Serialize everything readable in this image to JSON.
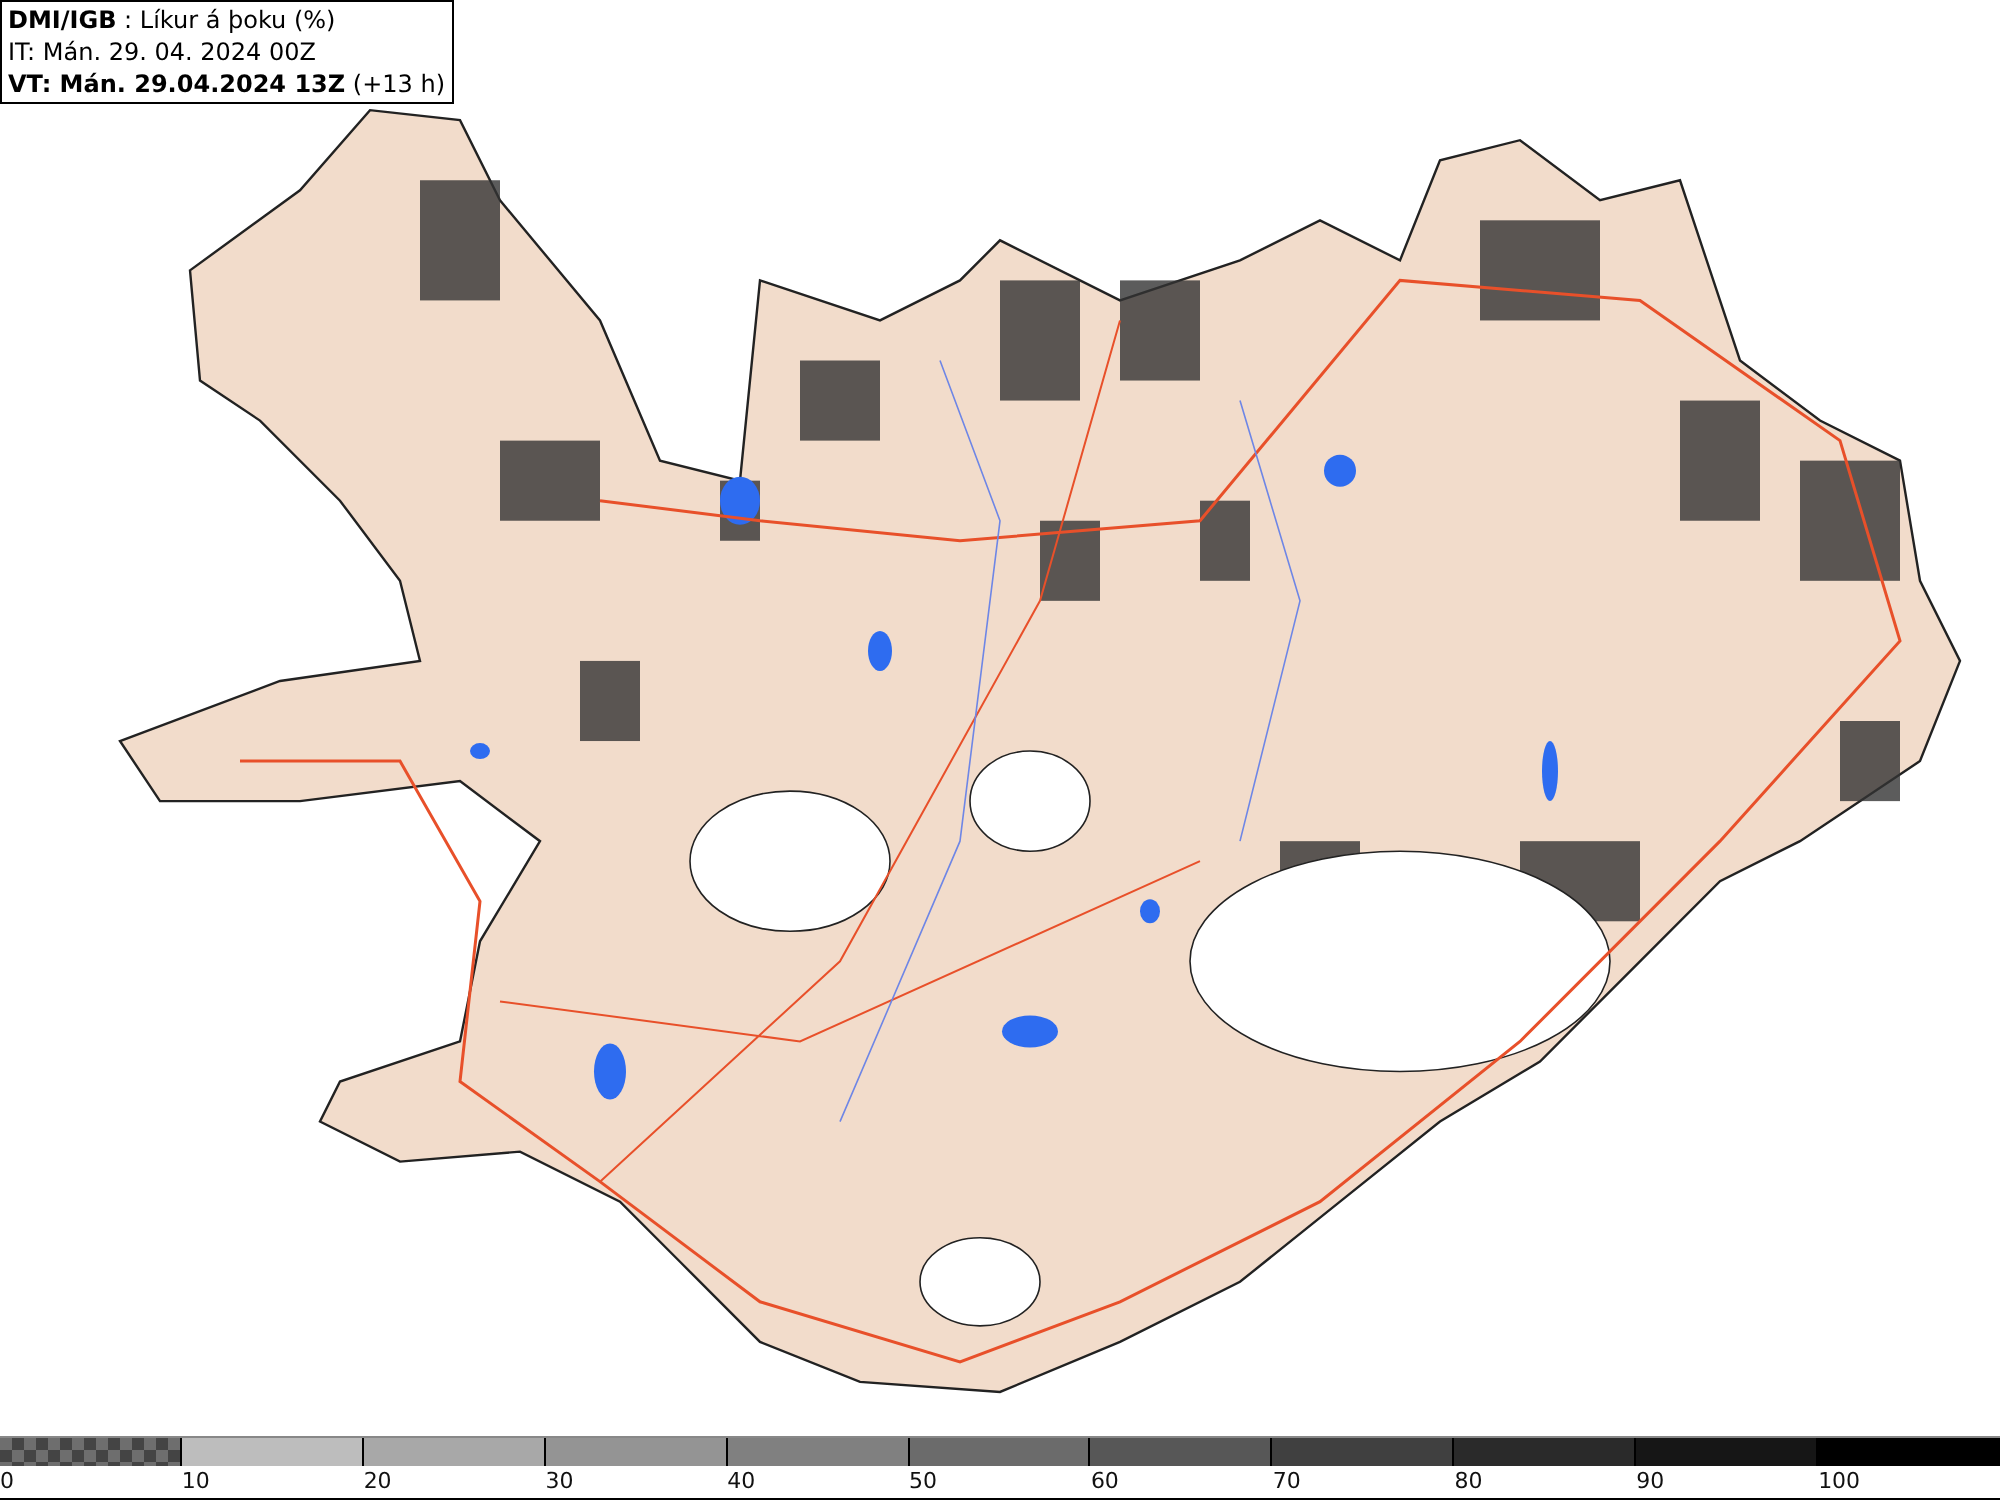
{
  "header": {
    "title_line": "**DMI/IGB** : Líkur á þoku (%)",
    "issue_line": "IT: Mán. 29. 04. 2024 00Z",
    "valid_line": "**VT: Mán. 29.04.2024 13Z** (+13 h)"
  },
  "legend": {
    "bins": [
      {
        "kind": "checker",
        "color": "#6e6e6e"
      },
      {
        "kind": "solid",
        "color": "#bdbdbd"
      },
      {
        "kind": "solid",
        "color": "#a8a8a8"
      },
      {
        "kind": "solid",
        "color": "#949494"
      },
      {
        "kind": "solid",
        "color": "#808080"
      },
      {
        "kind": "solid",
        "color": "#6b6b6b"
      },
      {
        "kind": "solid",
        "color": "#575757"
      },
      {
        "kind": "solid",
        "color": "#404040"
      },
      {
        "kind": "solid",
        "color": "#2a2a2a"
      },
      {
        "kind": "solid",
        "color": "#161616"
      },
      {
        "kind": "solid",
        "color": "#000000"
      }
    ],
    "labels": [
      "0",
      "10",
      "20",
      "30",
      "40",
      "50",
      "60",
      "70",
      "80",
      "90",
      "100"
    ]
  }
}
